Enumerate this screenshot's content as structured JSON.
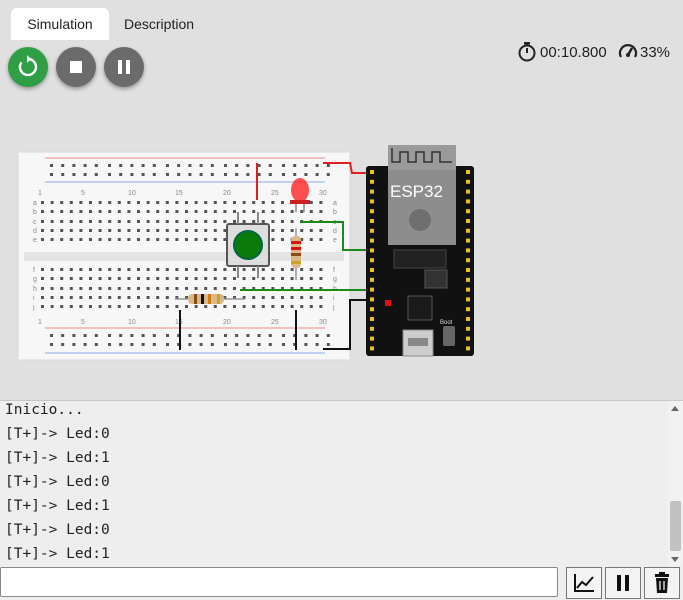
{
  "tabs": [
    {
      "label": "Simulation",
      "active": true
    },
    {
      "label": "Description",
      "active": false
    }
  ],
  "controls": {
    "restart_icon": "restart-icon",
    "stop_icon": "stop-icon",
    "pause_icon": "pause-icon"
  },
  "status": {
    "timer": "00:10.800",
    "speed": "33%"
  },
  "board": {
    "label": "ESP32",
    "boot_label": "Boot"
  },
  "breadboard": {
    "column_numbers": [
      "1",
      "5",
      "10",
      "15",
      "20",
      "25",
      "30"
    ],
    "row_letters_top": [
      "a",
      "b",
      "c",
      "d",
      "e"
    ],
    "row_letters_bottom": [
      "f",
      "g",
      "h",
      "i",
      "j"
    ]
  },
  "serial_monitor": {
    "lines": [
      "Inicio...",
      "[T+]-> Led:0",
      "[T+]-> Led:1",
      "[T+]-> Led:0",
      "[T+]-> Led:1",
      "[T+]-> Led:0",
      "[T+]-> Led:1"
    ],
    "input_value": ""
  },
  "colors": {
    "restart_green": "#2f9e44",
    "control_gray": "#6b6b6b",
    "wire_red": "#e02020",
    "wire_green": "#1a8a1a",
    "led_red": "#ff3030",
    "button_green": "#0a7a0a"
  }
}
